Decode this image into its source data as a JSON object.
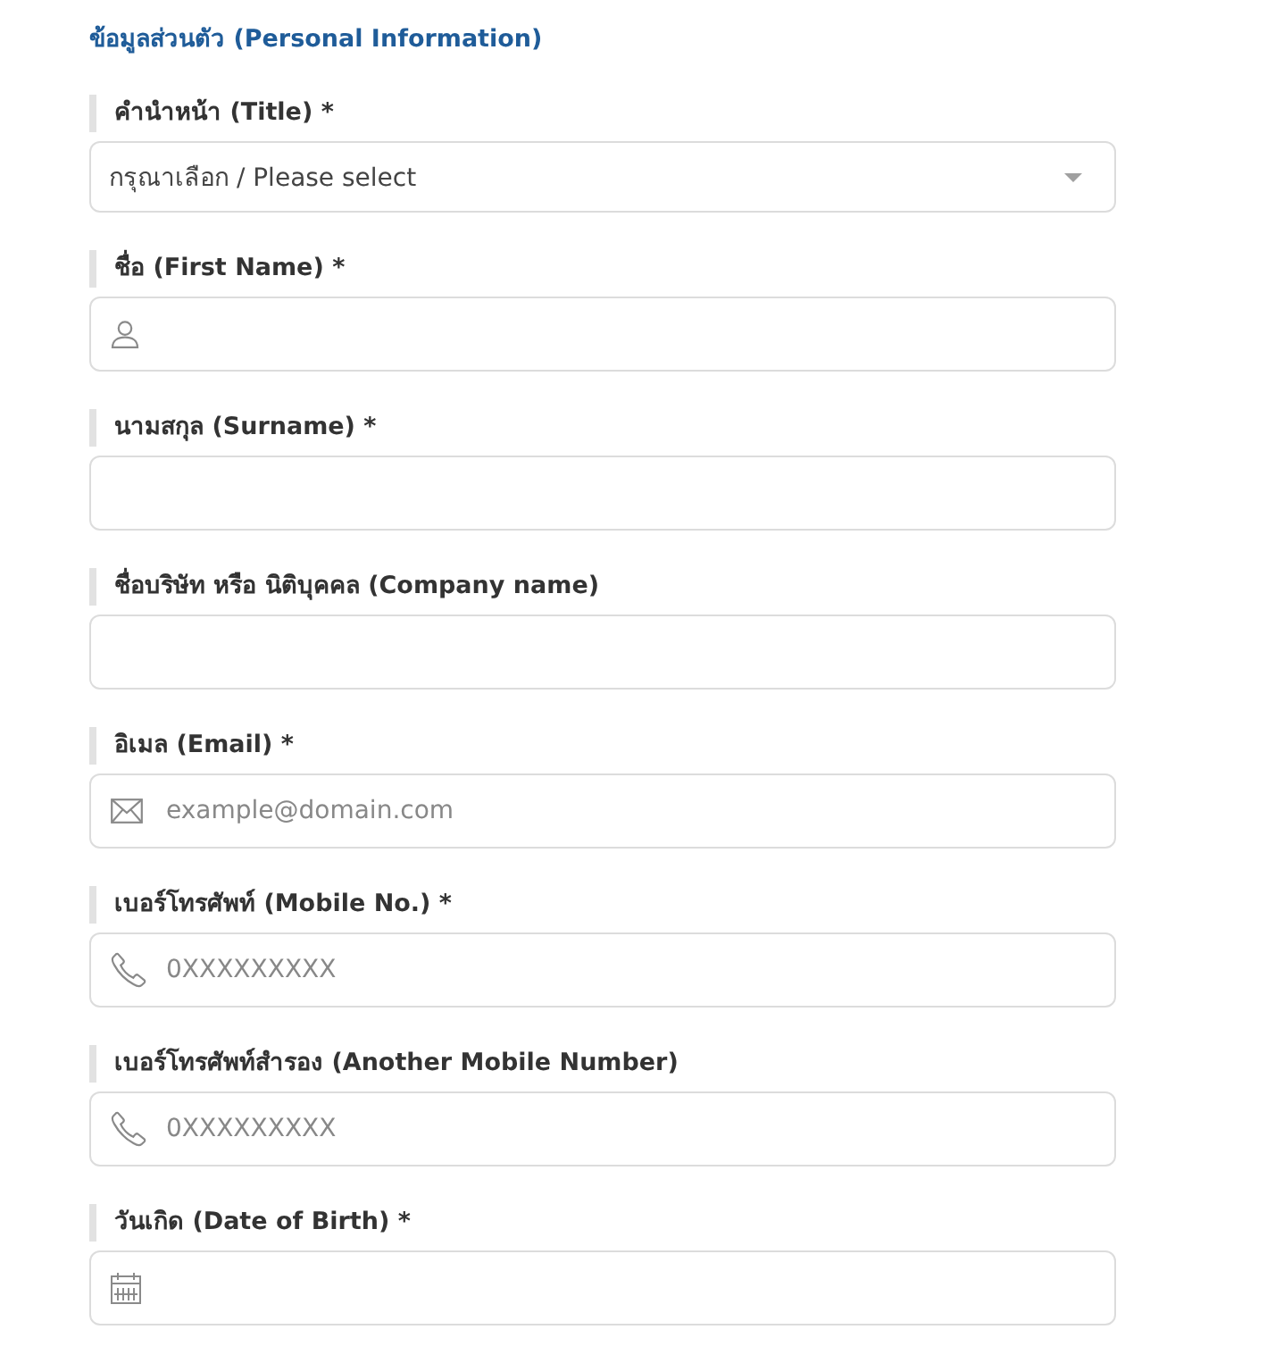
{
  "section": {
    "title": "ข้อมูลส่วนตัว (Personal Information)"
  },
  "fields": [
    {
      "kind": "select",
      "label": "คำนำหน้า (Title) *",
      "placeholder": "กรุณาเลือก / Please select"
    },
    {
      "kind": "person",
      "label": "ชื่อ (First Name) *"
    },
    {
      "kind": "text",
      "label": "นามสกุล (Surname) *"
    },
    {
      "kind": "text",
      "label": "ชื่อบริษัท หรือ นิติบุคคล (Company name)"
    },
    {
      "kind": "email",
      "label": "อิเมล (Email) *",
      "placeholder": "example@domain.com"
    },
    {
      "kind": "phone",
      "label": "เบอร์โทรศัพท์ (Mobile No.) *",
      "placeholder": "0XXXXXXXXX"
    },
    {
      "kind": "phone",
      "label": "เบอร์โทรศัพท์สำรอง (Another Mobile Number)",
      "placeholder": "0XXXXXXXXX"
    },
    {
      "kind": "date",
      "label": "วันเกิด (Date of Birth) *"
    }
  ]
}
